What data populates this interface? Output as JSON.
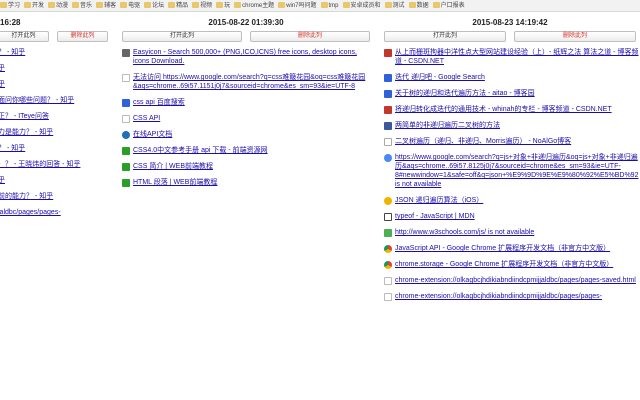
{
  "bookmarks": [
    "学习",
    "开发",
    "动漫",
    "音乐",
    "辅客",
    "电驱",
    "论坛",
    "精品",
    "视频",
    "玩",
    "chrome主题",
    "win7吗问题",
    "tmp",
    "安卓成员和",
    "测试",
    "数据",
    "户口报表"
  ],
  "columns": [
    {
      "timestamp": "16:28",
      "open_label": "打开此列",
      "delete_label": "删除此列",
      "items": [
        {
          "icon": "blank",
          "title": "？ - 知乎"
        },
        {
          "icon": "blank",
          "title": "乎"
        },
        {
          "icon": "blank",
          "title": "乎"
        },
        {
          "icon": "blank",
          "title": "面问你哪些问题？ - 知乎"
        },
        {
          "icon": "blank",
          "title": "正？ - ITeye问答"
        },
        {
          "icon": "blank",
          "title": "力是能力？ - 知乎"
        },
        {
          "icon": "blank",
          "title": "？ - 知乎"
        },
        {
          "icon": "blank",
          "title": "）？ - 王晓炜的回答 - 知乎"
        },
        {
          "icon": "blank",
          "title": "乎"
        },
        {
          "icon": "blank",
          "title": "前的能力？ - 知乎"
        },
        {
          "icon": "blank",
          "title": "jaldbc/pages/pages-"
        }
      ]
    },
    {
      "timestamp": "2015-08-22 01:39:30",
      "open_label": "打开此列",
      "delete_label": "删除此列",
      "items": [
        {
          "icon": "fa",
          "title": "Easyicon - Search 500,000+ (PNG,ICO,ICNS) free icons, desktop icons, icons Download."
        },
        {
          "icon": "blank",
          "title": "无法访问 https://www.google.com/search?q=css难簸花园&oq=css难簸花园&aqs=chrome..69i57.1151j0j7&sourceid=chrome&es_sm=93&ie=UTF-8"
        },
        {
          "icon": "baidu",
          "title": "css api 百度搜索"
        },
        {
          "icon": "blank",
          "title": "CSS API"
        },
        {
          "icon": "e",
          "title": "在线API文档"
        },
        {
          "icon": "w3s",
          "title": "CSS4.0中文参考手册 api 下载 - 前端资源网"
        },
        {
          "icon": "w3s",
          "title": "CSS 简介 | WEB前端教程"
        },
        {
          "icon": "w3s",
          "title": "HTML 段落 | WEB前端教程"
        }
      ]
    },
    {
      "timestamp": "2015-08-23 14:19:42",
      "open_label": "打开此列",
      "delete_label": "删除此列",
      "items": [
        {
          "icon": "csdn",
          "title": "从上而栅斑拘器中洋性点大型网站建设经验（上）- 纸辉之法 算法之道 - 博客频道 - CSDN.NET"
        },
        {
          "icon": "baidu",
          "title": "迭代 递归吧 - Google Search"
        },
        {
          "icon": "baidu",
          "title": "关于树的递归和迭代遍历方法 - aitao - 博客园"
        },
        {
          "icon": "csdn",
          "title": "将递归转化成迭代的通用技术 - whinah的专栏 - 博客频道 - CSDN.NET"
        },
        {
          "icon": "fb",
          "title": "两简单的非递归遍历二叉树的方法"
        },
        {
          "icon": "noa",
          "title": "二叉树遍历（递归、非递归、Morris遍历） - NoAlGo博客"
        },
        {
          "icon": "g",
          "title": "https://www.google.com/search?q=js+对象+非递归遍历&oq=js+对象+非递归遍历&aqs=chrome..69i57.8125j0j7&sourceid=chrome&es_sm=93&ie=UTF-8#newwindow=1&safe=off&q=json+%E9%9D%9E%E9%80%92%E5%BD%92 is not available"
        },
        {
          "icon": "json",
          "title": "JSON 递归遍历算法（iOS）"
        },
        {
          "icon": "mdn",
          "title": "typeof - JavaScript | MDN"
        },
        {
          "icon": "w3",
          "title": "http://www.w3schools.com/js/ is not available"
        },
        {
          "icon": "chrome",
          "title": "JavaScript API - Google Chrome 扩展程序开发文档（非官方中文版）"
        },
        {
          "icon": "chrome",
          "title": "chrome.storage - Google Chrome 扩展程序开发文档（非官方中文版）"
        },
        {
          "icon": "blank",
          "title": "chrome-extension://olkagbcjhdikiabndiindcpmijjaldbc/pages/pages-saved.html"
        },
        {
          "icon": "blank",
          "title": "chrome-extension://olkagbcjhdikiabndiindcpmijjaldbc/pages/pages-"
        }
      ]
    }
  ]
}
